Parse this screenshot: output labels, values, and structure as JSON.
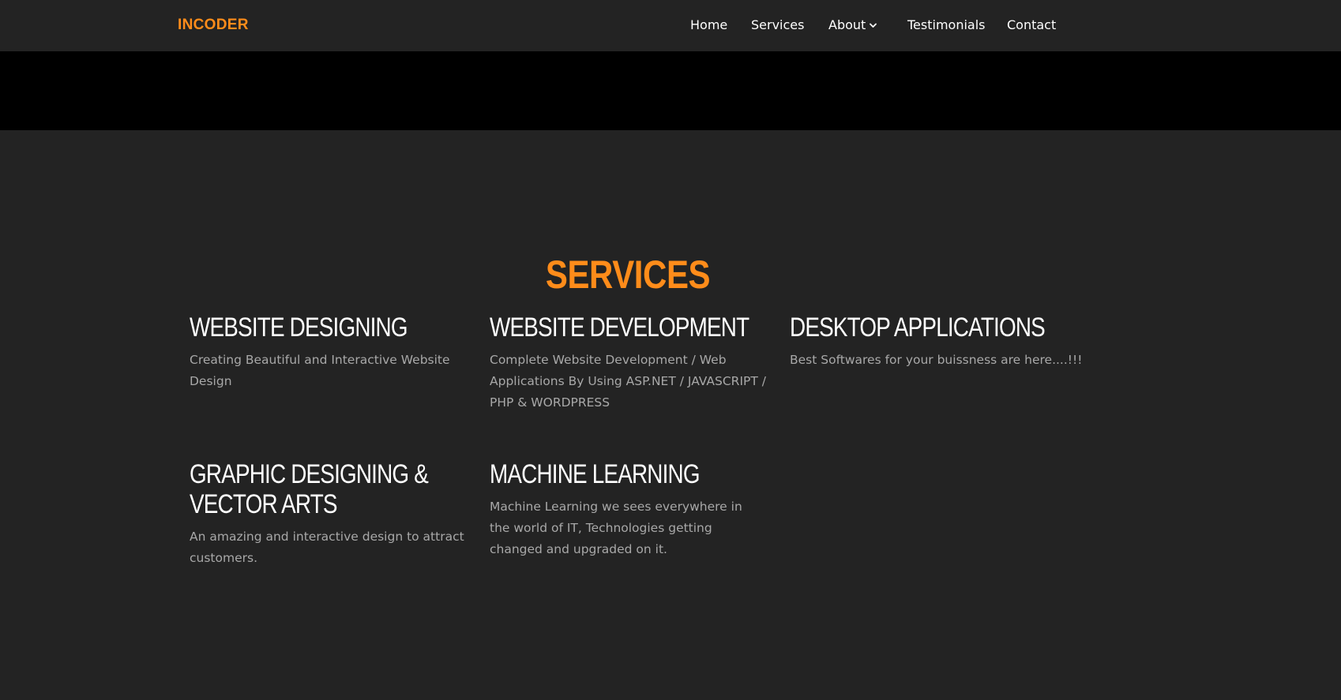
{
  "header": {
    "brand": "INCODER",
    "nav": {
      "home": "Home",
      "services": "Services",
      "about": "About",
      "testimonials": "Testimonials",
      "contact": "Contact"
    }
  },
  "services": {
    "title": "SERVICES",
    "items": [
      {
        "title": "WEBSITE DESIGNING",
        "description": "Creating Beautiful and Interactive Website Design"
      },
      {
        "title": "WEBSITE DEVELOPMENT",
        "description": "Complete Website Development / Web Applications By Using ASP.NET / JAVASCRIPT / PHP & WORDPRESS"
      },
      {
        "title": "DESKTOP APPLICATIONS",
        "description": "Best Softwares for your buissness are here....!!!"
      },
      {
        "title": "GRAPHIC DESIGNING & VECTOR ARTS",
        "description": "An amazing and interactive design to attract customers."
      },
      {
        "title": "MACHINE LEARNING",
        "description": "Machine Learning we sees everywhere in the world of IT, Technologies getting changed and upgraded on it."
      }
    ]
  },
  "colors": {
    "accent": "#ff8c1a",
    "background": "#232323",
    "hero": "#000000",
    "text": "#ffffff",
    "muted": "#a8a8a8"
  },
  "icons": {
    "about_dropdown": "chevron-down-icon"
  }
}
